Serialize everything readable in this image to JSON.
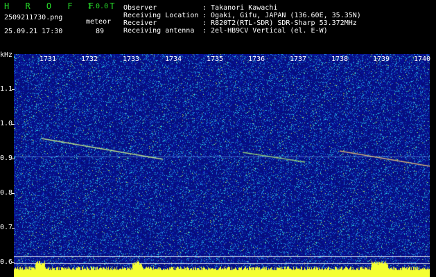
{
  "header": {
    "app_title": "H R O F F T",
    "version": "1.0.0",
    "filename": "2509211730.png",
    "mode": "meteor",
    "datetime": "25.09.21 17:30",
    "count": "89"
  },
  "info": {
    "labels": [
      "Observer",
      "Receiving Location",
      "Receiver",
      "Receiving antenna"
    ],
    "values": [
      ": Takanori Kawachi",
      ": Ogaki, Gifu, JAPAN (136.60E, 35.35N)",
      ": R820T2(RTL-SDR) SDR-Sharp 53.372MHz",
      ": 2el-HB9CV Vertical (el. E-W)"
    ]
  },
  "axis": {
    "y_unit": "kHz",
    "y_ticks": [
      "1.1",
      "1.0",
      "0.9",
      "0.8",
      "0.7",
      "0.6"
    ],
    "x_ticks": [
      "1731",
      "1732",
      "1733",
      "1734",
      "1735",
      "1736",
      "1737",
      "1738",
      "1739",
      "1740"
    ]
  },
  "colors": {
    "background": "#000000",
    "header_green": "#27e02a",
    "spectrum_base": "#0b1a8c",
    "trail": "#ffffff",
    "baseline": "#f4ff33"
  }
}
